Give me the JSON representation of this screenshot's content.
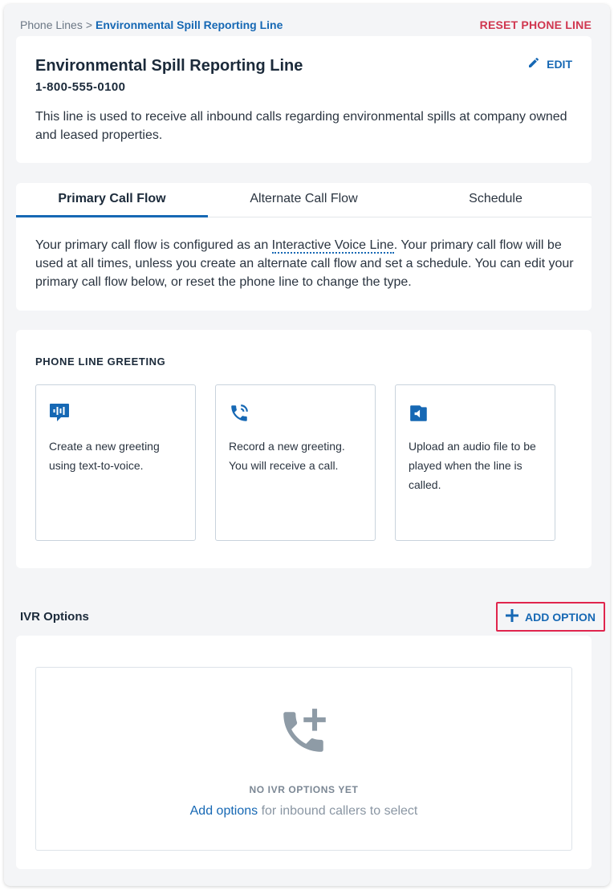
{
  "breadcrumb": {
    "root": "Phone Lines",
    "separator": ">",
    "current": "Environmental Spill Reporting Line"
  },
  "header": {
    "reset_label": "RESET PHONE LINE"
  },
  "line": {
    "title": "Environmental Spill Reporting Line",
    "phone": "1-800-555-0100",
    "description": "This line is used to receive all inbound calls regarding environmental spills at company owned and leased properties.",
    "edit_label": "EDIT"
  },
  "tabs": [
    {
      "label": "Primary Call Flow",
      "active": true
    },
    {
      "label": "Alternate Call Flow",
      "active": false
    },
    {
      "label": "Schedule",
      "active": false
    }
  ],
  "flow": {
    "desc_before": "Your primary call flow is configured as an ",
    "desc_link": "Interactive Voice Line",
    "desc_after": ". Your primary call flow will be used at all times, unless you create an alternate call flow and set a schedule. You can edit your primary call flow below, or reset the phone line to change the type."
  },
  "greeting": {
    "label": "PHONE LINE GREETING",
    "options": [
      {
        "icon": "text-to-voice-icon",
        "text": "Create a new greeting using text-to-voice."
      },
      {
        "icon": "phone-call-icon",
        "text": "Record a new greeting. You will receive a call."
      },
      {
        "icon": "audio-file-icon",
        "text": "Upload an audio file to be played when the line is called."
      }
    ]
  },
  "ivr": {
    "label": "IVR Options",
    "add_label": "ADD OPTION",
    "empty_title": "NO IVR OPTIONS YET",
    "empty_link": "Add options",
    "empty_rest": " for inbound callers to select"
  },
  "colors": {
    "accent": "#1668b4",
    "reset": "#d0364f",
    "highlight_border": "#e0254d",
    "empty_icon": "#8e9ba6"
  }
}
